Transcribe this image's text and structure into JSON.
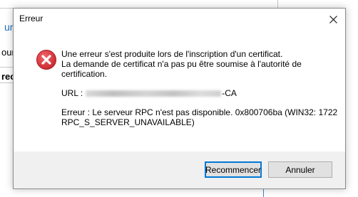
{
  "background": {
    "frag1": "urs",
    "frag2": "our",
    "frag3": "rec"
  },
  "dialog": {
    "title": "Erreur",
    "close_icon": "close-icon",
    "icon": "error-icon",
    "message_lines": [
      "Une erreur s'est produite lors de l'inscription d'un certificat.",
      "La demande de certificat n'a pas pu être soumise à l'autorité de",
      "certification."
    ],
    "url_label": "URL :",
    "url_suffix": "-CA",
    "error_lines": [
      "Erreur : Le serveur RPC n'est pas disponible. 0x800706ba (WIN32: 1722",
      "RPC_S_SERVER_UNAVAILABLE)"
    ],
    "buttons": {
      "retry": "Recommencer",
      "cancel": "Annuler"
    }
  },
  "colors": {
    "error_red": "#d9313b",
    "accent_blue": "#0078d7",
    "footer_bg": "#f0f0f0"
  }
}
